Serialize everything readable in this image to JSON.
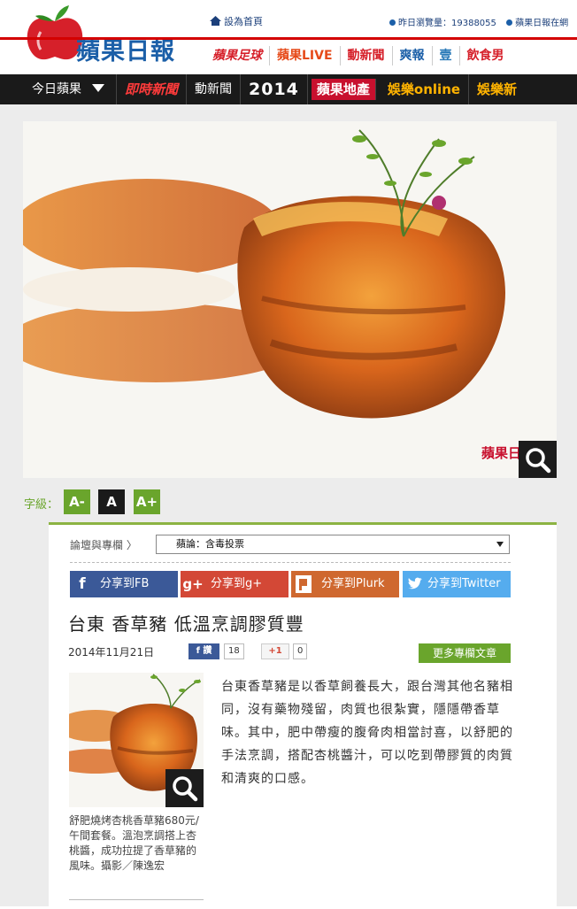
{
  "header": {
    "logo_text": "蘋果日報",
    "home_link": "設為首頁",
    "stats_label": "昨日瀏覽量：",
    "stats_value": "19388055",
    "subscribe_label": "蘋果日報在網",
    "sublinks": [
      "蘋果足球",
      "蘋果LIVE",
      "動新聞",
      "爽報",
      "壹",
      "飲食男"
    ]
  },
  "nav": {
    "items": [
      "今日蘋果",
      "即時新聞",
      "動新聞",
      "2014",
      "蘋果地產",
      "娛樂online",
      "娛樂新"
    ]
  },
  "hero": {
    "watermark": "蘋果日"
  },
  "font_size": {
    "label": "字級：",
    "small": "A-",
    "normal": "A",
    "large": "A+"
  },
  "forum": {
    "label": "論壇與專欄 〉",
    "selected": "蘋論：含毒投票"
  },
  "share": {
    "fb": "分享到FB",
    "gplus": "分享到g+",
    "plurk": "分享到Plurk",
    "twitter": "分享到Twitter"
  },
  "article": {
    "title": "台東 香草豬 低溫烹調膠質豐",
    "date": "2014年11月21日",
    "fb_label": "讚",
    "fb_count": "18",
    "gplus_label": "+1",
    "gplus_count": "0",
    "more_button": "更多專欄文章",
    "caption": "舒肥燒烤杏桃香草豬680元/午間套餐。溫泡烹調搭上杏桃醬，成功拉提了香草豬的風味。攝影／陳逸宏",
    "body": "台東香草豬是以香草飼養長大，跟台灣其他名豬相同，沒有藥物殘留，肉質也很紮實，隱隱帶香草味。其中，肥中帶瘦的腹脅肉相當討喜，以舒肥的手法烹調，搭配杏桃醬汁，可以吃到帶膠質的肉質和清爽的口感。"
  },
  "colors": {
    "brand_blue": "#1b5fa8",
    "brand_red": "#d40000",
    "accent_green": "#6aa52c",
    "nav_bg": "#1a1a1a",
    "fb": "#3b5998",
    "gplus": "#d34836",
    "plurk": "#cf682f",
    "twitter": "#55acee"
  }
}
